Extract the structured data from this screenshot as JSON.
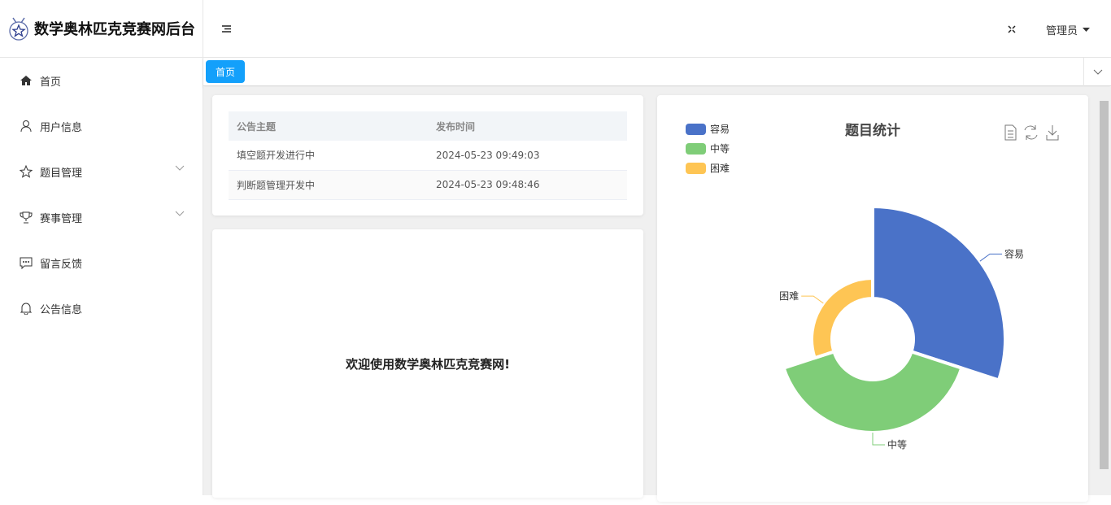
{
  "app": {
    "title": "数学奥林匹克竞赛网后台"
  },
  "sidebar": {
    "items": [
      {
        "label": "首页"
      },
      {
        "label": "用户信息"
      },
      {
        "label": "题目管理"
      },
      {
        "label": "赛事管理"
      },
      {
        "label": "留言反馈"
      },
      {
        "label": "公告信息"
      }
    ]
  },
  "header": {
    "user": "管理员"
  },
  "tabs": {
    "active": "首页"
  },
  "notices": {
    "headers": [
      "公告主题",
      "发布时间"
    ],
    "rows": [
      [
        "填空题开发进行中",
        "2024-05-23 09:49:03"
      ],
      [
        "判断题管理开发中",
        "2024-05-23 09:48:46"
      ]
    ]
  },
  "welcome": "欢迎使用数学奥林匹克竞赛网!",
  "chart_data": {
    "type": "pie",
    "rose": true,
    "title": "题目统计",
    "categories": [
      "容易",
      "中等",
      "困难"
    ],
    "values": [
      3,
      4,
      3
    ],
    "colors": [
      "#4a72c8",
      "#7fcd78",
      "#fec554"
    ],
    "legend_position": "top-left"
  }
}
